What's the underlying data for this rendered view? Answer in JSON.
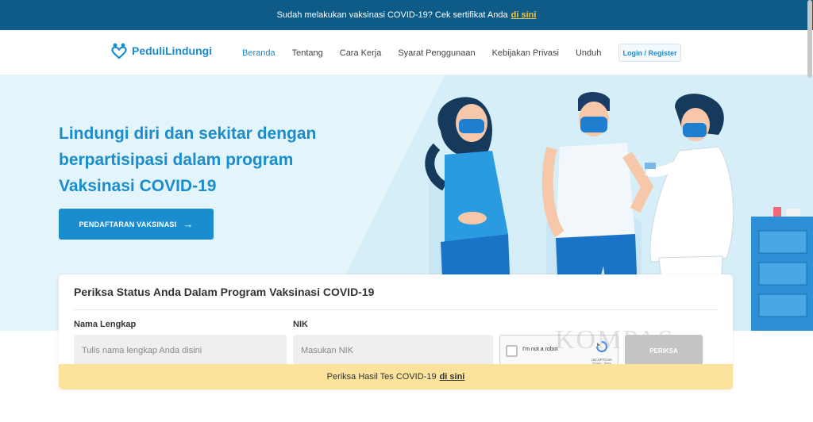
{
  "topbar": {
    "message": "Sudah melakukan vaksinasi COVID-19? Cek sertifikat Anda",
    "link": "di sini"
  },
  "header": {
    "brand": "PeduliLindungi",
    "nav": [
      "Beranda",
      "Tentang",
      "Cara Kerja",
      "Syarat Penggunaan",
      "Kebijakan Privasi",
      "Unduh"
    ],
    "active_nav": "Beranda",
    "login": "Login / Register"
  },
  "hero": {
    "title": "Lindungi diri dan sekitar dengan berpartisipasi dalam program Vaksinasi COVID-19",
    "cta": "PENDAFTARAN VAKSINASI"
  },
  "form": {
    "title": "Periksa Status Anda Dalam Program Vaksinasi COVID-19",
    "name_label": "Nama Lengkap",
    "name_placeholder": "Tulis nama lengkap Anda disini",
    "nik_label": "NIK",
    "nik_placeholder": "Masukan NIK",
    "captcha_text": "I'm not a robot",
    "captcha_brand": "reCAPTCHA",
    "captcha_sub": "Privacy - Terms",
    "submit": "PERIKSA",
    "watermark": "KOMPAS"
  },
  "footer_banner": {
    "message": "Periksa Hasil Tes COVID-19",
    "link": "di sini"
  },
  "colors": {
    "topbar": "#0d5b86",
    "accent": "#1a8dcf",
    "hero_bg": "#e4f4fb",
    "yellow": "#fbe39b"
  }
}
